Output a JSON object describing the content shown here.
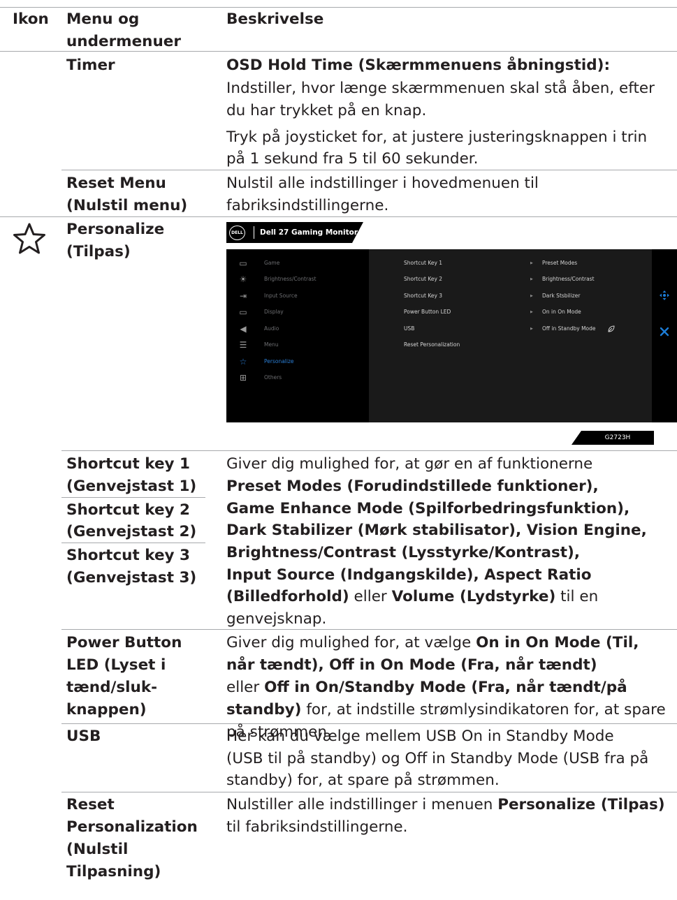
{
  "header": {
    "col_icon": "Ikon",
    "col_menu_line1": "Menu og",
    "col_menu_line2": "undermenuer",
    "col_desc": "Beskrivelse"
  },
  "timer": {
    "name": "Timer",
    "title": "OSD Hold Time (Skærmmenuens åbningstid):",
    "desc1_line1": "Indstiller, hvor længe skærmmenuen skal stå åben, efter",
    "desc1_line2": "du har trykket på en knap.",
    "desc2_line1": "Tryk på joysticket for, at justere justeringsknappen i trin",
    "desc2_line2": "på 1 sekund fra 5 til 60 sekunder."
  },
  "reset_menu": {
    "name_line1": "Reset Menu",
    "name_line2": "(Nulstil menu)",
    "desc_line1": "Nulstil alle indstillinger i hovedmenuen til",
    "desc_line2": "fabriksindstillingerne."
  },
  "personalize": {
    "icon": "star-outline-icon",
    "name_line1": "Personalize",
    "name_line2": "(Tilpas)"
  },
  "osd": {
    "logo_text": "DELL",
    "title": "Dell 27 Gaming Monitor",
    "model": "G2723H",
    "menu": [
      {
        "icon": "game-icon",
        "glyph": "▭",
        "label": "Game"
      },
      {
        "icon": "brightness-icon",
        "glyph": "☀",
        "label": "Brightness/Contrast"
      },
      {
        "icon": "input-source-icon",
        "glyph": "⇥",
        "label": "Input Source"
      },
      {
        "icon": "display-icon",
        "glyph": "▭",
        "label": "Display"
      },
      {
        "icon": "audio-icon",
        "glyph": "◀",
        "label": "Audio"
      },
      {
        "icon": "menu-icon",
        "glyph": "☰",
        "label": "Menu"
      },
      {
        "icon": "personalize-icon",
        "glyph": "☆",
        "label": "Personalize"
      },
      {
        "icon": "others-icon",
        "glyph": "⊞",
        "label": "Others"
      }
    ],
    "settings": [
      {
        "key": "Shortcut Key 1",
        "arrow": "▶",
        "value": "Preset Modes"
      },
      {
        "key": "Shortcut Key 2",
        "arrow": "▶",
        "value": "Brightness/Contrast"
      },
      {
        "key": "Shortcut Key 3",
        "arrow": "▶",
        "value": "Dark Stsbilizer"
      },
      {
        "key": "Power Button LED",
        "arrow": "▶",
        "value": "On in On Mode"
      },
      {
        "key": "USB",
        "arrow": "▶",
        "value": "Off in Standby Mode"
      },
      {
        "key": "Reset Personalization",
        "arrow": "",
        "value": ""
      }
    ],
    "control_move_icon": "move-icon",
    "control_close_icon": "close-icon"
  },
  "shortcut": {
    "name1_line1": "Shortcut key 1",
    "name1_line2": "(Genvejstast 1)",
    "name2_line1": "Shortcut key 2",
    "name2_line2": "(Genvejstast 2)",
    "name3_line1": "Shortcut key 3",
    "name3_line2": "(Genvejstast 3)",
    "d1": "Giver dig mulighed for, at gør en af funktionerne",
    "d2": "Preset Modes (Forudindstillede funktioner),",
    "d3": "Game Enhance Mode (Spilforbedringsfunktion),",
    "d4": "Dark Stabilizer (Mørk stabilisator), Vision Engine,",
    "d5": "Brightness/Contrast (Lysstyrke/Kontrast),",
    "d6": "Input Source (Indgangskilde), Aspect Ratio",
    "d7a": "(Billedforhold)",
    "d7b": " eller ",
    "d7c": "Volume (Lydstyrke)",
    "d7d": " til en",
    "d8": "genvejsknap."
  },
  "power_led": {
    "name_line1": "Power Button",
    "name_line2": "LED (Lyset i",
    "name_line3": "tænd/sluk-",
    "name_line4": "knappen)",
    "d1a": "Giver dig mulighed for, at vælge ",
    "d1b": "On in On Mode (Til,",
    "d2": "når tændt), Off in On Mode (Fra, når tændt)",
    "d3a": "eller ",
    "d3b": "Off in On/Standby Mode (Fra, når tændt/på",
    "d4a": "standby)",
    "d4b": " for, at indstille strømlysindikatoren for, at spare",
    "d5": "på strømmen."
  },
  "usb": {
    "name": "USB",
    "d1": "Her kan du vælge mellem USB On in Standby Mode",
    "d2": "(USB til på standby) og Off in Standby Mode (USB fra på",
    "d3": "standby) for, at spare på strømmen."
  },
  "reset_personalization": {
    "name_line1": "Reset",
    "name_line2": "Personalization",
    "name_line3": "(Nulstil",
    "name_line4": "Tilpasning)",
    "d1a": "Nulstiller alle indstillinger i menuen ",
    "d1b": "Personalize (Tilpas)",
    "d2": "til fabriksindstillingerne."
  }
}
